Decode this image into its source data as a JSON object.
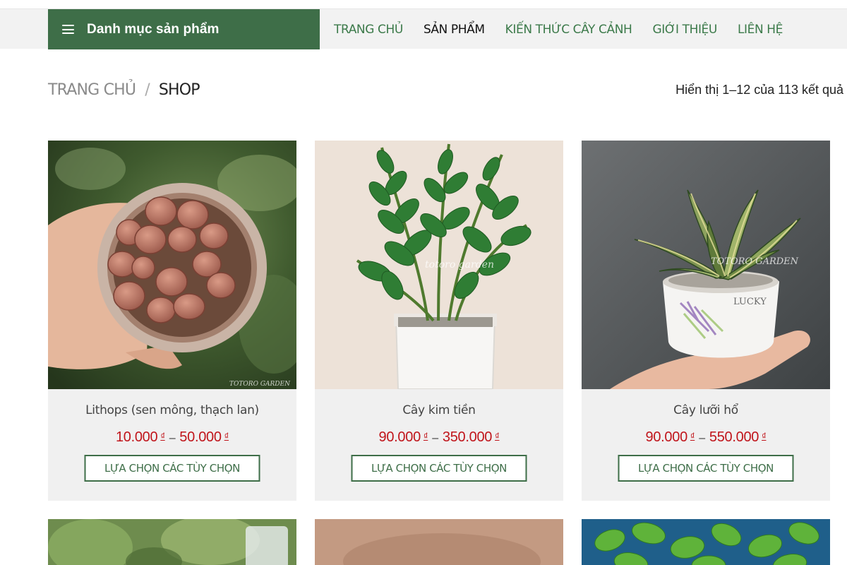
{
  "header": {
    "category_menu_label": "Danh mục sản phẩm",
    "nav": [
      {
        "label": "TRANG CHỦ"
      },
      {
        "label": "SẢN PHẨM"
      },
      {
        "label": "KIẾN THỨC CÂY CẢNH"
      },
      {
        "label": "GIỚI THIỆU"
      },
      {
        "label": "LIÊN HỆ"
      }
    ],
    "active_nav": "SẢN PHẨM"
  },
  "breadcrumb": {
    "home": "TRANG CHỦ",
    "separator": "/",
    "current": "SHOP"
  },
  "result_count": "Hiển thị 1–12 của 113 kết quả",
  "products": [
    {
      "name": "Lithops (sen mông, thạch lan)",
      "price_min": "10.000",
      "price_max": "50.000",
      "currency": "₫",
      "price_separator": "–",
      "button": "LỰA CHỌN CÁC TÙY CHỌN",
      "image_icon": "lithops-photo",
      "watermark": "TOTORO GARDEN"
    },
    {
      "name": "Cây kim tiền",
      "price_min": "90.000",
      "price_max": "350.000",
      "currency": "₫",
      "price_separator": "–",
      "button": "LỰA CHỌN CÁC TÙY CHỌN",
      "image_icon": "zz-plant-photo",
      "watermark": "totoro garden"
    },
    {
      "name": "Cây lưỡi hổ",
      "price_min": "90.000",
      "price_max": "550.000",
      "currency": "₫",
      "price_separator": "–",
      "button": "LỰA CHỌN CÁC TÙY CHỌN",
      "image_icon": "snake-plant-photo",
      "watermark": "TOTORO GARDEN",
      "pot_text": "LUCKY"
    }
  ],
  "colors": {
    "brand_green": "#3e6e48",
    "price_red": "#c0151b",
    "card_bg": "#f0f0f0"
  }
}
